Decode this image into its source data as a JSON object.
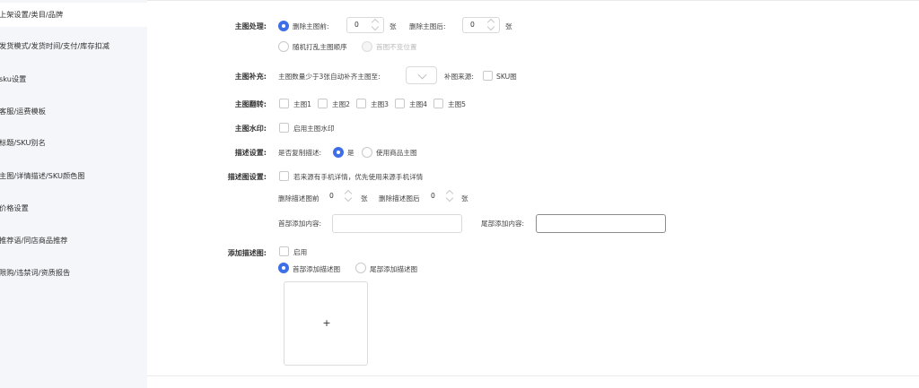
{
  "sidebar": {
    "items": [
      {
        "label": "上架设置/类目/品牌"
      },
      {
        "label": "发货模式/发货时间/支付/库存扣减"
      },
      {
        "label": "sku设置"
      },
      {
        "label": "客服/运费模板"
      },
      {
        "label": "标题/SKU别名"
      },
      {
        "label": "主图/详情描述/SKU颜色图"
      },
      {
        "label": "价格设置"
      },
      {
        "label": "推荐语/同店商品推荐"
      },
      {
        "label": "限购/违禁词/资质报告"
      }
    ]
  },
  "main_image_processing": {
    "label": "主图处理:",
    "delete_before_label": "删除主图前:",
    "delete_before_value": "0",
    "unit1": "张",
    "delete_after_label": "删除主图后:",
    "delete_after_value": "0",
    "unit2": "张",
    "shuffle_label": "随机打乱主图顺序",
    "keep_first_label": "首图不变位置"
  },
  "main_image_fill": {
    "label": "主图补充:",
    "desc": "主图数量少于3张自动补齐主图至:",
    "source_label": "补图来源:",
    "sku_label": "SKU图"
  },
  "main_image_flip": {
    "label": "主图翻转:",
    "options": [
      "主图1",
      "主图2",
      "主图3",
      "主图4",
      "主图5"
    ]
  },
  "main_image_watermark": {
    "label": "主图水印:",
    "enable_label": "启用主图水印"
  },
  "description_settings": {
    "label": "描述设置:",
    "copy_label": "是否复制描述:",
    "yes_label": "是",
    "use_main_label": "使用商品主图"
  },
  "description_image_settings": {
    "label": "描述图设置:",
    "prefer_mobile_label": "若来源有手机详情，优先使用来源手机详情",
    "delete_before_label": "删除描述图前",
    "delete_before_value": "0",
    "unit1": "张",
    "delete_after_label": "删除描述图后",
    "delete_after_value": "0",
    "unit2": "张",
    "head_content_label": "首部添加内容:",
    "tail_content_label": "尾部添加内容:"
  },
  "add_description_image": {
    "label": "添加描述图:",
    "enable_label": "启用",
    "head_add_label": "首部添加描述图",
    "tail_add_label": "尾部添加描述图",
    "upload_plus": "+"
  },
  "colors": {
    "accent": "#3e6fe6",
    "sidebar_bg": "#f5f6fa"
  }
}
